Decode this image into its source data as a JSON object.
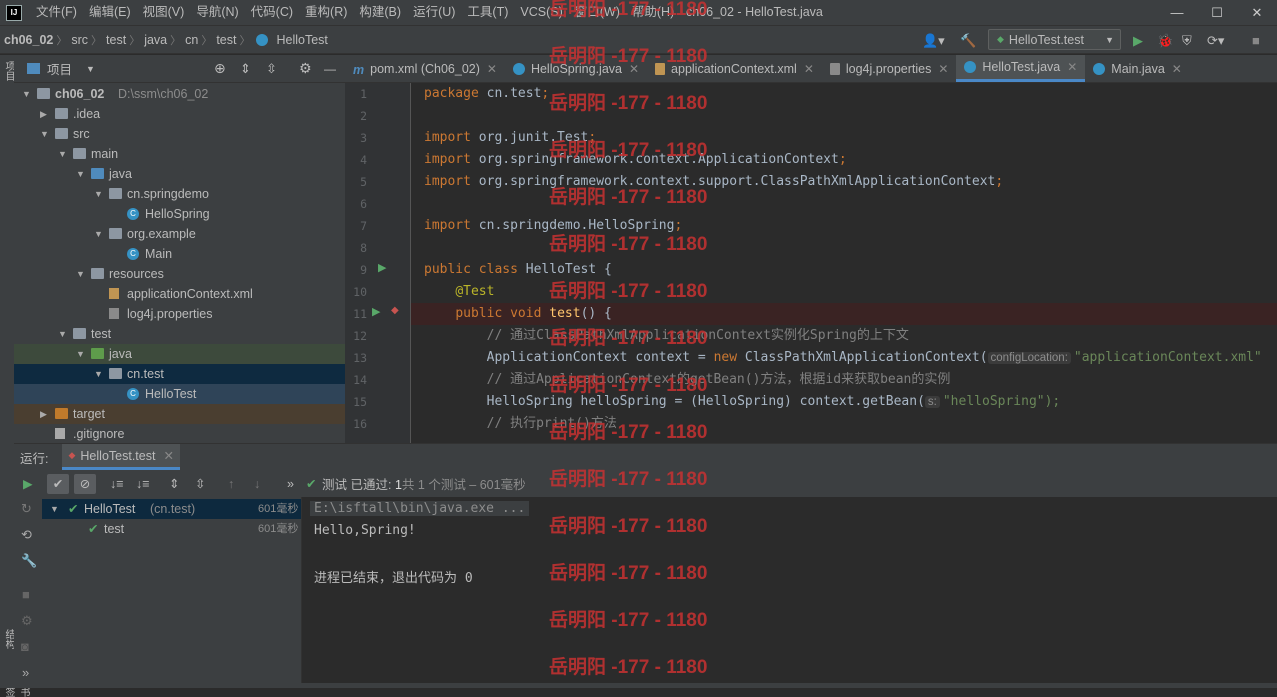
{
  "menu": [
    "文件(F)",
    "编辑(E)",
    "视图(V)",
    "导航(N)",
    "代码(C)",
    "重构(R)",
    "构建(B)",
    "运行(U)",
    "工具(T)",
    "VCS(S)",
    "窗口(W)",
    "帮助(H)"
  ],
  "window_title": "ch06_02 - HelloTest.java",
  "breadcrumbs": [
    "ch06_02",
    "src",
    "test",
    "java",
    "cn",
    "test",
    "HelloTest"
  ],
  "run_config": "HelloTest.test",
  "project_panel": {
    "title": "项目",
    "tree": [
      {
        "label": "ch06_02",
        "extra": "D:\\ssm\\ch06_02",
        "depth": 0,
        "arrow": "down",
        "icon": "folder",
        "bold": true
      },
      {
        "label": ".idea",
        "depth": 1,
        "arrow": "right",
        "icon": "folder"
      },
      {
        "label": "src",
        "depth": 1,
        "arrow": "down",
        "icon": "folder"
      },
      {
        "label": "main",
        "depth": 2,
        "arrow": "down",
        "icon": "folder"
      },
      {
        "label": "java",
        "depth": 3,
        "arrow": "down",
        "icon": "folder-blue"
      },
      {
        "label": "cn.springdemo",
        "depth": 4,
        "arrow": "down",
        "icon": "folder"
      },
      {
        "label": "HelloSpring",
        "depth": 5,
        "arrow": "",
        "icon": "class"
      },
      {
        "label": "org.example",
        "depth": 4,
        "arrow": "down",
        "icon": "folder"
      },
      {
        "label": "Main",
        "depth": 5,
        "arrow": "",
        "icon": "class"
      },
      {
        "label": "resources",
        "depth": 3,
        "arrow": "down",
        "icon": "folder"
      },
      {
        "label": "applicationContext.xml",
        "depth": 4,
        "arrow": "",
        "icon": "xml"
      },
      {
        "label": "log4j.properties",
        "depth": 4,
        "arrow": "",
        "icon": "prop"
      },
      {
        "label": "test",
        "depth": 2,
        "arrow": "down",
        "icon": "folder"
      },
      {
        "label": "java",
        "depth": 3,
        "arrow": "down",
        "icon": "folder-green"
      },
      {
        "label": "cn.test",
        "depth": 4,
        "arrow": "down",
        "icon": "folder"
      },
      {
        "label": "HelloTest",
        "depth": 5,
        "arrow": "",
        "icon": "class"
      },
      {
        "label": "target",
        "depth": 1,
        "arrow": "right",
        "icon": "folder-orange"
      },
      {
        "label": ".gitignore",
        "depth": 1,
        "arrow": "",
        "icon": "file"
      }
    ]
  },
  "tabs": [
    {
      "label": "pom.xml (Ch06_02)",
      "icon": "m"
    },
    {
      "label": "HelloSpring.java",
      "icon": "class"
    },
    {
      "label": "applicationContext.xml",
      "icon": "xml"
    },
    {
      "label": "log4j.properties",
      "icon": "prop"
    },
    {
      "label": "HelloTest.java",
      "icon": "class",
      "active": true
    },
    {
      "label": "Main.java",
      "icon": "class"
    }
  ],
  "code": {
    "line_numbers": [
      "1",
      "2",
      "3",
      "4",
      "5",
      "6",
      "7",
      "8",
      "9",
      "10",
      "11",
      "12",
      "13",
      "14",
      "15",
      "16"
    ],
    "lines": [
      "package cn.test;",
      "",
      "import org.junit.Test;",
      "import org.springframework.context.ApplicationContext;",
      "import org.springframework.context.support.ClassPathXmlApplicationContext;",
      "",
      "import cn.springdemo.HelloSpring;",
      "",
      "public class HelloTest {",
      "    @Test",
      "    public void test() {",
      "        // 通过ClassPathXmlApplicationContext实例化Spring的上下文",
      "        ApplicationContext context = new ClassPathXmlApplicationContext(",
      "        // 通过ApplicationContext的getBean()方法，根据id来获取bean的实例",
      "        HelloSpring helloSpring = (HelloSpring) context.getBean(",
      "        // 执行print()方法"
    ],
    "hint_config": "configLocation:",
    "hint_config_value": "\"applicationContext.xml\"",
    "hint_s": "s:",
    "hint_s_value": "\"helloSpring\");"
  },
  "run_panel": {
    "label": "运行:",
    "tab": "HelloTest.test",
    "status_prefix": "测试",
    "status_passed": "已通过:",
    "status_count": "1",
    "status_rest": "共 1 个测试 – 601毫秒",
    "tests": [
      {
        "label": "HelloTest",
        "extra": "(cn.test)",
        "time": "601毫秒"
      },
      {
        "label": "test",
        "extra": "",
        "time": "601毫秒"
      }
    ],
    "console": [
      "E:\\isftall\\bin\\java.exe ...",
      "Hello,Spring!",
      "",
      "进程已结束，退出代码为 0"
    ]
  },
  "left_strip_labels": [
    "项目",
    "结构",
    "书签"
  ],
  "watermark": "岳明阳 -177 - 1180"
}
